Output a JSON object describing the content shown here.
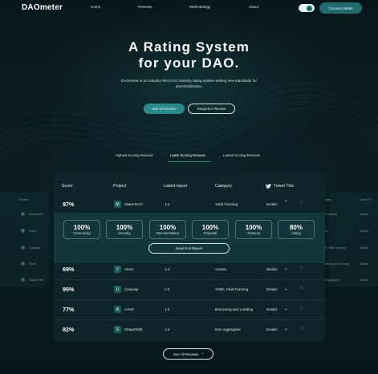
{
  "brand": {
    "logo": "DAOmeter"
  },
  "nav": {
    "items": [
      "Home",
      "Reviews",
      "Methodology",
      "About"
    ],
    "connect_label": "Connect Wallet"
  },
  "hero": {
    "title_line1": "A Rating System",
    "title_line2": "for your DAO.",
    "subtitle": "DAOmeter is an industry-first DAO maturity rating system setting new standards for decentralization.",
    "primary_cta": "See DAOmeter",
    "secondary_cta": "Request A Review"
  },
  "tabs": [
    "Highest Scoring Reviews",
    "Latest Scoring Reviews",
    "Lowest Scoring Reviews"
  ],
  "active_tab": "Latest Scoring Reviews",
  "table": {
    "headers": [
      "Score",
      "Project",
      "Latest report",
      "Category",
      "Tweet This"
    ],
    "rows": [
      {
        "score": "97%",
        "project": "MakerDAO",
        "report": "1.0",
        "category": "Yield Farming",
        "details": "Details"
      },
      {
        "score": "69%",
        "project": "Yearn",
        "report": "1.0",
        "category": "Assets",
        "details": "Details"
      },
      {
        "score": "95%",
        "project": "Uniswap",
        "report": "1.0",
        "category": "AMM, Yield Farming",
        "details": "Details"
      },
      {
        "score": "77%",
        "project": "AAVE",
        "report": "1.0",
        "category": "Borrowing and Lending",
        "details": "Details"
      },
      {
        "score": "82%",
        "project": "ShapeShift",
        "report": "1.0",
        "category": "Dex Aggregator",
        "details": "Details"
      }
    ],
    "expanded_metrics": [
      {
        "value": "100%",
        "label": "Community"
      },
      {
        "value": "100%",
        "label": "Security"
      },
      {
        "value": "100%",
        "label": "Documentation"
      },
      {
        "value": "100%",
        "label": "Proposal"
      },
      {
        "value": "100%",
        "label": "Treasury"
      },
      {
        "value": "80%",
        "label": "Voting"
      }
    ],
    "read_full_label": "Read Full Report"
  },
  "ghost_left": {
    "header": "Project",
    "items": [
      "MakerDAO",
      "Yearn",
      "Uniswap",
      "AAVE",
      "ShapeShift"
    ]
  },
  "ghost_right": {
    "headers": [
      "Category",
      "Tweet Th"
    ],
    "items": [
      "Yield Farming",
      "Assets",
      "AMM, Yield Farming",
      "Borrowing and Lending",
      "Dex Aggregator"
    ],
    "details": "Details"
  },
  "see_all_label": "See All Reviews",
  "colors": {
    "accent": "#2a8a8c",
    "background": "#081a1d",
    "panel": "#0d2428"
  }
}
